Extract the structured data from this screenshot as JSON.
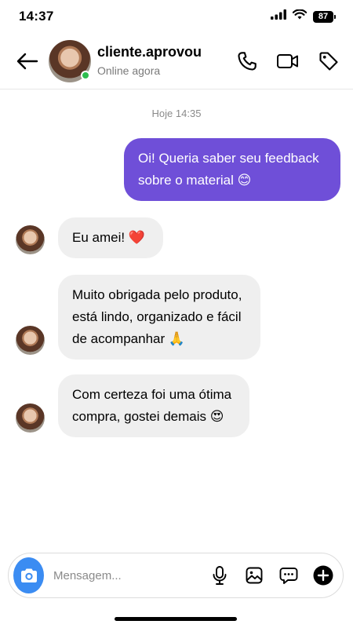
{
  "status_bar": {
    "time": "14:37",
    "battery": "87"
  },
  "header": {
    "contact_name": "cliente.aprovou",
    "contact_status": "Online agora"
  },
  "chat": {
    "timestamp": "Hoje 14:35",
    "outgoing": [
      {
        "text": "Oi! Queria saber seu feedback sobre o material 😊"
      }
    ],
    "incoming": [
      {
        "text": "Eu amei! ❤️"
      },
      {
        "text": "Muito obrigada pelo produto, está lindo, organizado e fácil de acompanhar 🙏"
      },
      {
        "text": "Com certeza foi uma ótima compra, gostei demais 😍"
      }
    ]
  },
  "composer": {
    "placeholder": "Mensagem...",
    "value": ""
  },
  "icons": {
    "back": "back-arrow-icon",
    "call": "phone-icon",
    "video": "video-camera-icon",
    "tag": "tag-icon",
    "camera": "camera-icon",
    "mic": "microphone-icon",
    "gallery": "image-icon",
    "sticker": "chat-bubble-icon",
    "add": "plus-circle-icon"
  },
  "colors": {
    "outgoing_bubble": "#6f4fd8",
    "incoming_bubble": "#efefef",
    "online": "#2dbd4e",
    "camera_button": "#3b8cf2"
  }
}
